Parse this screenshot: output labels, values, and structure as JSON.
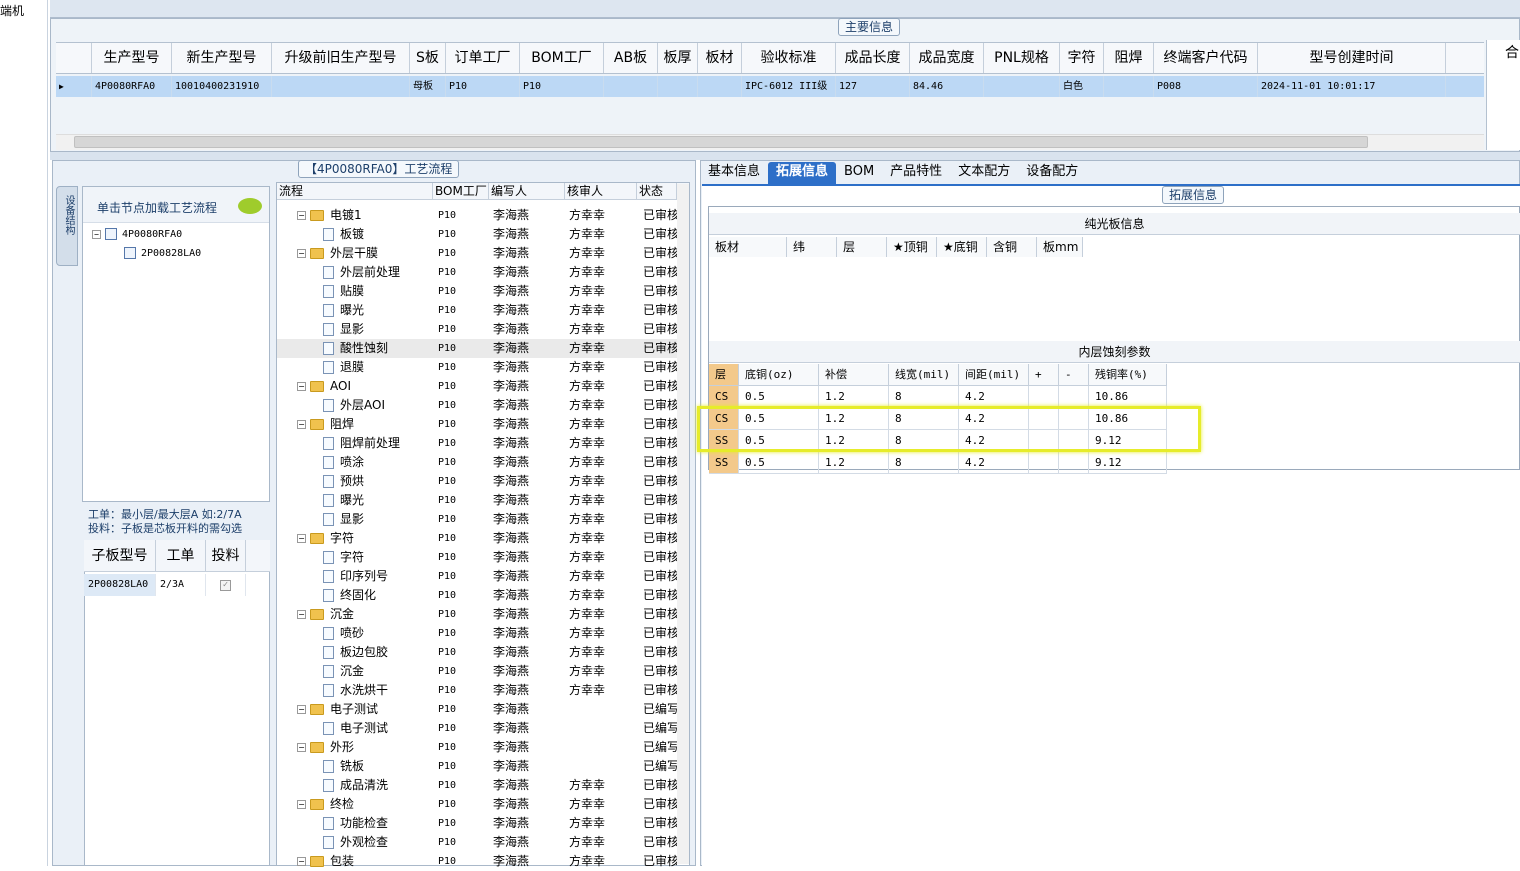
{
  "left_strip": {
    "label": "端机"
  },
  "main_info": {
    "group_title": "主要信息",
    "columns": [
      "生产型号",
      "新生产型号",
      "升级前旧生产型号",
      "S板",
      "订单工厂",
      "BOM工厂",
      "AB板",
      "板厚",
      "板材",
      "验收标准",
      "成品长度",
      "成品宽度",
      "PNL规格",
      "字符",
      "阻焊",
      "终端客户代码",
      "型号创建时间"
    ],
    "row": [
      "4P0080RFA0",
      "10010400231910",
      "",
      "母板",
      "P10",
      "P10",
      "",
      "",
      "",
      "IPC-6012 III级",
      "127",
      "84.46",
      "",
      "白色",
      "",
      "P008",
      "2024-11-01 10:01:17"
    ],
    "right_col_label": "合"
  },
  "process": {
    "group_title": "【4P0080RFA0】工艺流程",
    "side_tab": "设备结构",
    "node_header": "单击节点加载工艺流程",
    "tree": [
      "4P0080RFA0",
      "2P00828LA0"
    ],
    "tips": [
      "工单：最小层/最大层A 如:2/7A",
      "投料：子板是芯板开料的需勾选"
    ],
    "subgrid_headers": [
      "子板型号",
      "工单",
      "投料"
    ],
    "subgrid_row": [
      "2P00828LA0",
      "2/3A",
      "✓"
    ],
    "headers": [
      "流程",
      "BOM工厂",
      "编写人",
      "核审人",
      "状态"
    ],
    "rows": [
      {
        "name": "电镀1",
        "type": "folder",
        "bom": "P10",
        "writer": "李海燕",
        "reviewer": "方幸幸",
        "status": "已审核"
      },
      {
        "name": "板镀",
        "type": "doc",
        "bom": "P10",
        "writer": "李海燕",
        "reviewer": "方幸幸",
        "status": "已审核"
      },
      {
        "name": "外层干膜",
        "type": "folder",
        "bom": "P10",
        "writer": "李海燕",
        "reviewer": "方幸幸",
        "status": "已审核"
      },
      {
        "name": "外层前处理",
        "type": "doc",
        "bom": "P10",
        "writer": "李海燕",
        "reviewer": "方幸幸",
        "status": "已审核"
      },
      {
        "name": "贴膜",
        "type": "doc",
        "bom": "P10",
        "writer": "李海燕",
        "reviewer": "方幸幸",
        "status": "已审核"
      },
      {
        "name": "曝光",
        "type": "doc",
        "bom": "P10",
        "writer": "李海燕",
        "reviewer": "方幸幸",
        "status": "已审核"
      },
      {
        "name": "显影",
        "type": "doc",
        "bom": "P10",
        "writer": "李海燕",
        "reviewer": "方幸幸",
        "status": "已审核"
      },
      {
        "name": "酸性蚀刻",
        "type": "doc",
        "bom": "P10",
        "writer": "李海燕",
        "reviewer": "方幸幸",
        "status": "已审核",
        "selected": true
      },
      {
        "name": "退膜",
        "type": "doc",
        "bom": "P10",
        "writer": "李海燕",
        "reviewer": "方幸幸",
        "status": "已审核"
      },
      {
        "name": "AOI",
        "type": "folder",
        "bom": "P10",
        "writer": "李海燕",
        "reviewer": "方幸幸",
        "status": "已审核"
      },
      {
        "name": "外层AOI",
        "type": "doc",
        "bom": "P10",
        "writer": "李海燕",
        "reviewer": "方幸幸",
        "status": "已审核"
      },
      {
        "name": "阻焊",
        "type": "folder",
        "bom": "P10",
        "writer": "李海燕",
        "reviewer": "方幸幸",
        "status": "已审核"
      },
      {
        "name": "阻焊前处理",
        "type": "doc",
        "bom": "P10",
        "writer": "李海燕",
        "reviewer": "方幸幸",
        "status": "已审核"
      },
      {
        "name": "喷涂",
        "type": "doc",
        "bom": "P10",
        "writer": "李海燕",
        "reviewer": "方幸幸",
        "status": "已审核"
      },
      {
        "name": "预烘",
        "type": "doc",
        "bom": "P10",
        "writer": "李海燕",
        "reviewer": "方幸幸",
        "status": "已审核"
      },
      {
        "name": "曝光",
        "type": "doc",
        "bom": "P10",
        "writer": "李海燕",
        "reviewer": "方幸幸",
        "status": "已审核"
      },
      {
        "name": "显影",
        "type": "doc",
        "bom": "P10",
        "writer": "李海燕",
        "reviewer": "方幸幸",
        "status": "已审核"
      },
      {
        "name": "字符",
        "type": "folder",
        "bom": "P10",
        "writer": "李海燕",
        "reviewer": "方幸幸",
        "status": "已审核"
      },
      {
        "name": "字符",
        "type": "doc",
        "bom": "P10",
        "writer": "李海燕",
        "reviewer": "方幸幸",
        "status": "已审核"
      },
      {
        "name": "印序列号",
        "type": "doc",
        "bom": "P10",
        "writer": "李海燕",
        "reviewer": "方幸幸",
        "status": "已审核"
      },
      {
        "name": "终固化",
        "type": "doc",
        "bom": "P10",
        "writer": "李海燕",
        "reviewer": "方幸幸",
        "status": "已审核"
      },
      {
        "name": "沉金",
        "type": "folder",
        "bom": "P10",
        "writer": "李海燕",
        "reviewer": "方幸幸",
        "status": "已审核"
      },
      {
        "name": "喷砂",
        "type": "doc",
        "bom": "P10",
        "writer": "李海燕",
        "reviewer": "方幸幸",
        "status": "已审核"
      },
      {
        "name": "板边包胶",
        "type": "doc",
        "bom": "P10",
        "writer": "李海燕",
        "reviewer": "方幸幸",
        "status": "已审核"
      },
      {
        "name": "沉金",
        "type": "doc",
        "bom": "P10",
        "writer": "李海燕",
        "reviewer": "方幸幸",
        "status": "已审核"
      },
      {
        "name": "水洗烘干",
        "type": "doc",
        "bom": "P10",
        "writer": "李海燕",
        "reviewer": "方幸幸",
        "status": "已审核"
      },
      {
        "name": "电子测试",
        "type": "folder",
        "bom": "P10",
        "writer": "李海燕",
        "reviewer": "",
        "status": "已编写"
      },
      {
        "name": "电子测试",
        "type": "doc",
        "bom": "P10",
        "writer": "李海燕",
        "reviewer": "",
        "status": "已编写"
      },
      {
        "name": "外形",
        "type": "folder",
        "bom": "P10",
        "writer": "李海燕",
        "reviewer": "",
        "status": "已编写"
      },
      {
        "name": "铣板",
        "type": "doc",
        "bom": "P10",
        "writer": "李海燕",
        "reviewer": "",
        "status": "已编写"
      },
      {
        "name": "成品清洗",
        "type": "doc",
        "bom": "P10",
        "writer": "李海燕",
        "reviewer": "方幸幸",
        "status": "已审核"
      },
      {
        "name": "终检",
        "type": "folder",
        "bom": "P10",
        "writer": "李海燕",
        "reviewer": "方幸幸",
        "status": "已审核"
      },
      {
        "name": "功能检查",
        "type": "doc",
        "bom": "P10",
        "writer": "李海燕",
        "reviewer": "方幸幸",
        "status": "已审核"
      },
      {
        "name": "外观检查",
        "type": "doc",
        "bom": "P10",
        "writer": "李海燕",
        "reviewer": "方幸幸",
        "status": "已审核"
      },
      {
        "name": "包装",
        "type": "folder",
        "bom": "P10",
        "writer": "李海燕",
        "reviewer": "方幸幸",
        "status": "已审核"
      }
    ]
  },
  "tabs": {
    "items": [
      "基本信息",
      "拓展信息",
      "BOM",
      "产品特性",
      "文本配方",
      "设备配方"
    ],
    "active": 1
  },
  "ext": {
    "group_title": "拓展信息",
    "bare_title": "纯光板信息",
    "bare_headers": [
      "板材",
      "纬",
      "层",
      "★顶铜",
      "★底铜",
      "含铜",
      "板mm"
    ],
    "etch_title": "内层蚀刻参数",
    "etch_headers": [
      "层",
      "底铜(oz)",
      "补偿",
      "线宽(mil)",
      "间距(mil)",
      "+",
      "-",
      "残铜率(%)"
    ],
    "etch_rows": [
      [
        "CS",
        "0.5",
        "1.2",
        "8",
        "4.2",
        "",
        "",
        "10.86"
      ],
      [
        "CS",
        "0.5",
        "1.2",
        "8",
        "4.2",
        "",
        "",
        "10.86"
      ],
      [
        "SS",
        "0.5",
        "1.2",
        "8",
        "4.2",
        "",
        "",
        "9.12"
      ],
      [
        "SS",
        "0.5",
        "1.2",
        "8",
        "4.2",
        "",
        "",
        "9.12"
      ]
    ]
  }
}
